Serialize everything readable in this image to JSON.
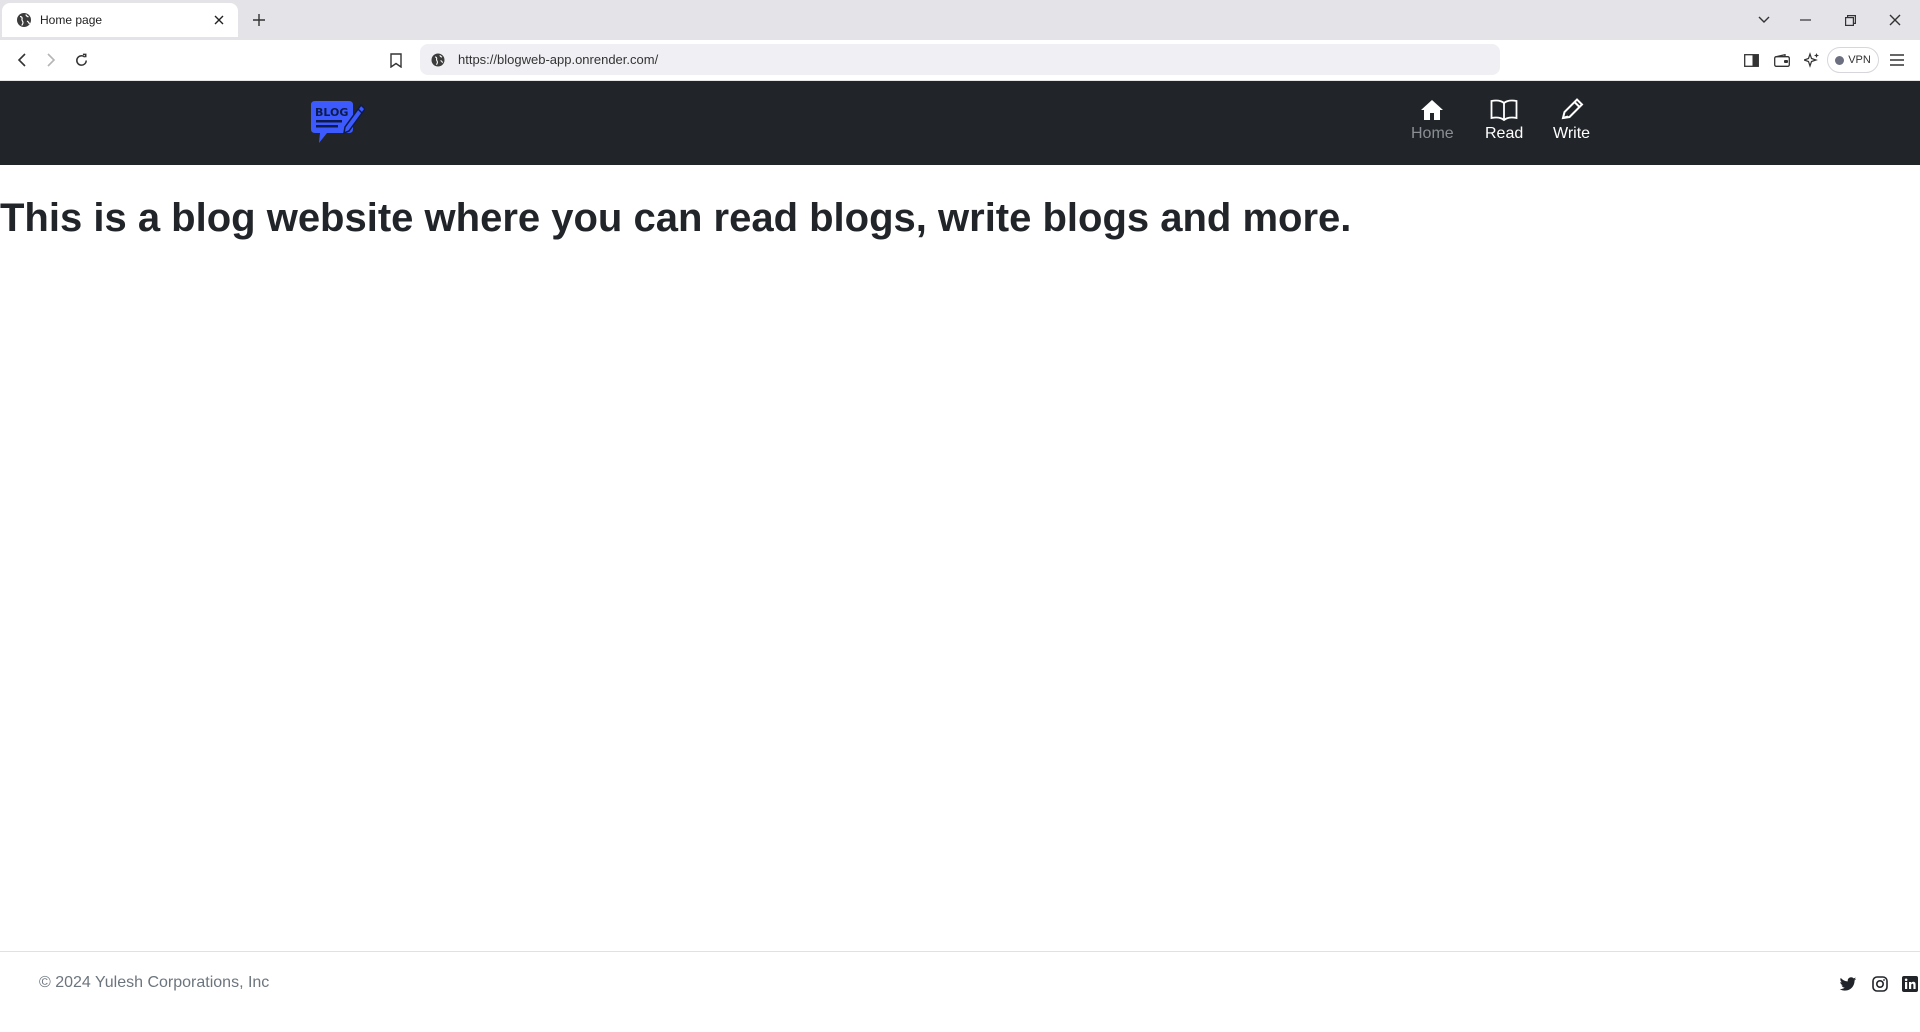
{
  "browser": {
    "tab": {
      "title": "Home page"
    },
    "address": {
      "url": "https://blogweb-app.onrender.com/"
    },
    "vpn_label": "VPN"
  },
  "site": {
    "logo_text": "BLOG",
    "nav": [
      {
        "label": "Home",
        "icon": "home-icon",
        "active": true
      },
      {
        "label": "Read",
        "icon": "book-icon",
        "active": false
      },
      {
        "label": "Write",
        "icon": "pencil-icon",
        "active": false
      }
    ],
    "headline": "This is a blog website where you can read blogs, write blogs and more.",
    "footer": {
      "copyright": "© 2024 Yulesh Corporations, Inc",
      "social": [
        "twitter-icon",
        "instagram-icon",
        "linkedin-icon"
      ]
    }
  },
  "colors": {
    "navbar_bg": "#212529",
    "nav_active": "#8a8f95",
    "logo_blue": "#3d5afe",
    "text_dark": "#212529",
    "footer_text": "#6c757d"
  }
}
